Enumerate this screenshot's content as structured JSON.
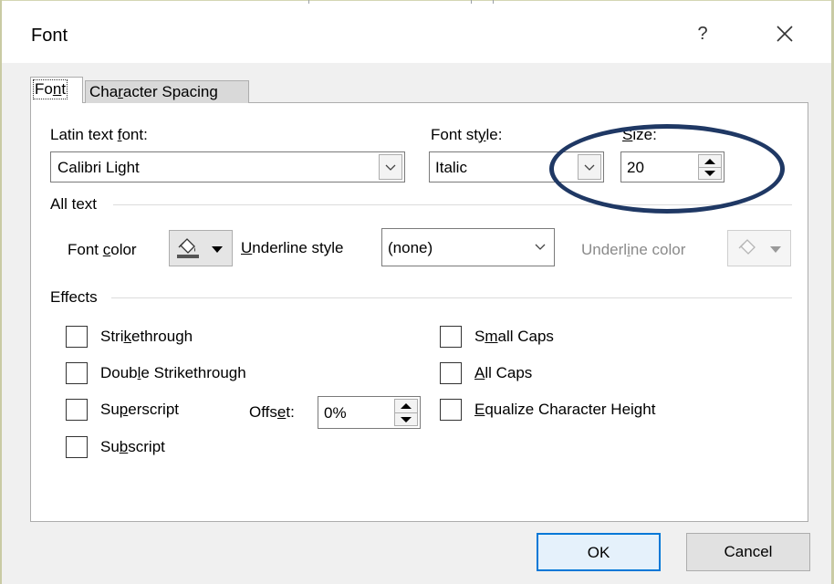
{
  "dialog": {
    "title": "Font",
    "help_label": "?",
    "accent_color": "#0078d7",
    "annotation_color": "#1f3864"
  },
  "tabs": [
    {
      "label": "Font",
      "underline_char": "n",
      "selected": true
    },
    {
      "label": "Character Spacing",
      "underline_char": "r",
      "selected": false
    }
  ],
  "font_section": {
    "latin_font_label": "Latin text font:",
    "latin_font_value": "Calibri Light",
    "style_label": "Font style:",
    "style_value": "Italic",
    "size_label": "Size:",
    "size_value": "20"
  },
  "all_text": {
    "group_label": "All text",
    "font_color_label": "Font color",
    "underline_style_label": "Underline style",
    "underline_style_value": "(none)",
    "underline_color_label": "Underline color"
  },
  "effects": {
    "group_label": "Effects",
    "strikethrough": "Strikethrough",
    "double_strikethrough": "Double Strikethrough",
    "superscript": "Superscript",
    "subscript": "Subscript",
    "offset_label": "Offset:",
    "offset_value": "0%",
    "small_caps": "Small Caps",
    "all_caps": "All Caps",
    "equalize": "Equalize Character Height"
  },
  "buttons": {
    "ok": "OK",
    "cancel": "Cancel"
  },
  "icons": [
    "close-icon",
    "chevron-down-icon",
    "spin-up-icon",
    "spin-down-icon",
    "paint-bucket-icon"
  ]
}
